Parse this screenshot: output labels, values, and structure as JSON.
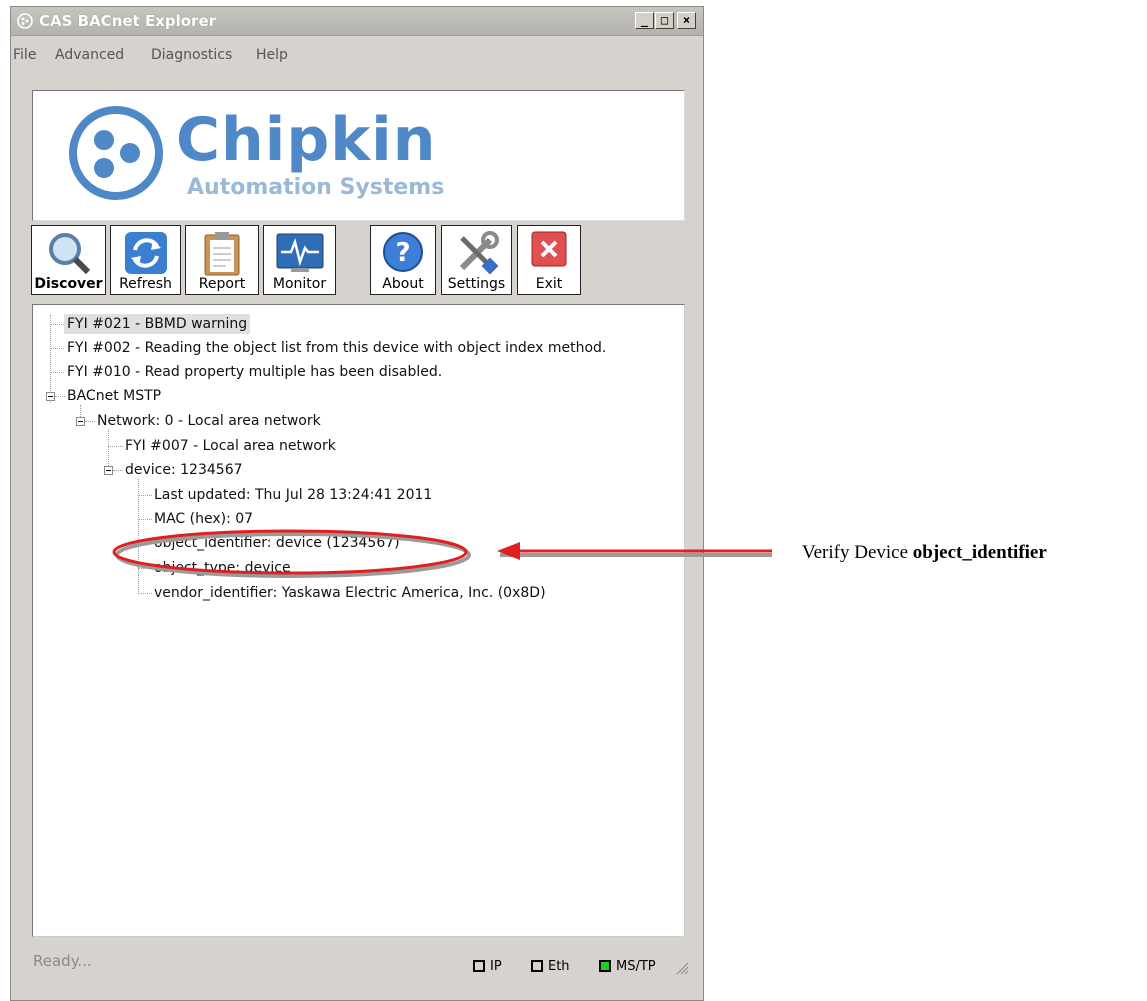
{
  "window": {
    "title": "CAS BACnet Explorer",
    "controls": [
      "_",
      "□",
      "×"
    ]
  },
  "menu": [
    "File",
    "Advanced",
    "Diagnostics",
    "Help"
  ],
  "logo": {
    "big": "Chipkin",
    "small": "Automation Systems"
  },
  "toolbar": [
    "Discover",
    "Refresh",
    "Report",
    "Monitor",
    "About",
    "Settings",
    "Exit"
  ],
  "tree": [
    "FYI #021 - BBMD warning",
    "FYI #002 - Reading the object list from this device with object index method.",
    "FYI #010 - Read property multiple has been disabled.",
    "BACnet MSTP",
    "Network: 0 - Local area network",
    "FYI #007 - Local area network",
    "device: 1234567",
    "Last updated: Thu Jul 28 13:24:41 2011",
    "MAC (hex): 07",
    "object_identifier: device (1234567)",
    "object_type: device",
    "vendor_identifier: Yaskawa Electric America, Inc. (0x8D)"
  ],
  "status": {
    "text": "Ready...",
    "indicators": [
      {
        "label": "IP",
        "color": "#ffffff"
      },
      {
        "label": "Eth",
        "color": "#ffffff"
      },
      {
        "label": "MS/TP",
        "color": "#22cc22"
      }
    ]
  },
  "annotation": {
    "prefix": "Verify Device ",
    "bold": "object_identifier"
  },
  "colors": {
    "highlight": "#e02020",
    "logo_blue": "#4e88c7"
  }
}
